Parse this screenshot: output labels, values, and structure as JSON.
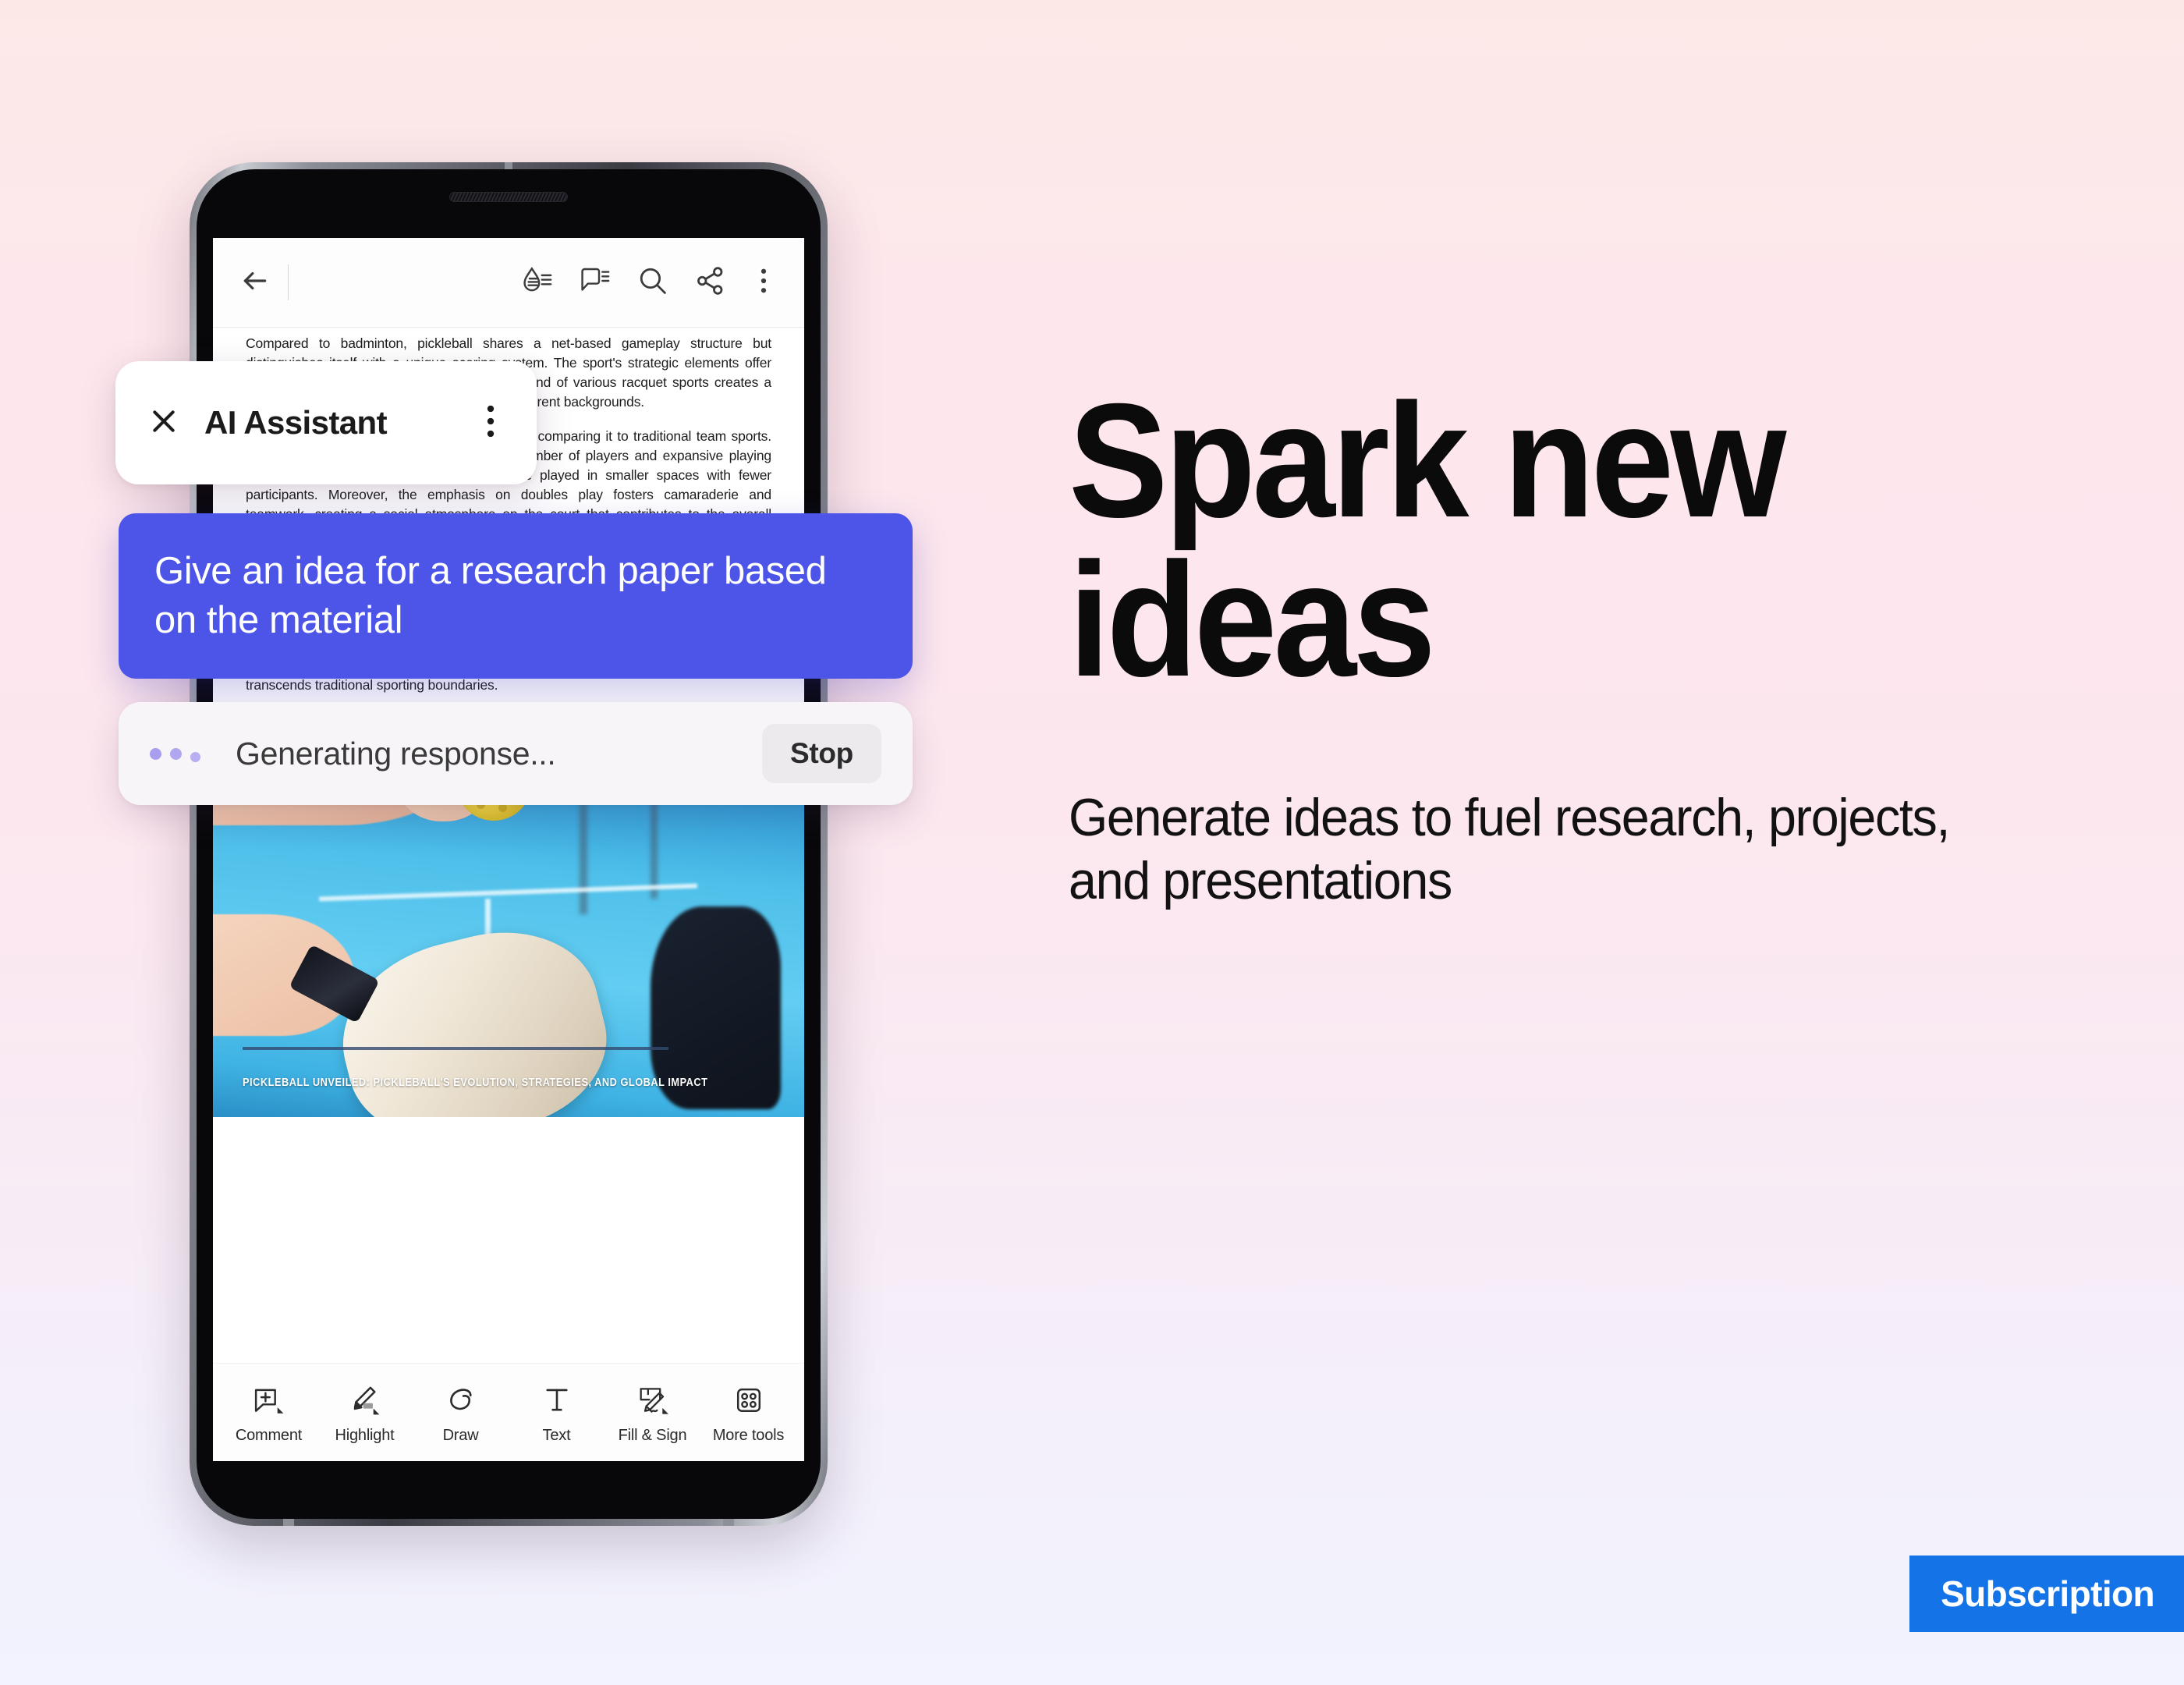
{
  "background": {
    "gradient_top": "#fce9e7",
    "gradient_bottom": "#f2f3fe"
  },
  "phone": {
    "app_toolbar": {
      "back_icon": "back-arrow-icon",
      "icons": [
        {
          "name": "liquid-mode-icon",
          "label": "Liquid Mode"
        },
        {
          "name": "comment-icon",
          "label": "Comment"
        },
        {
          "name": "search-icon",
          "label": "Search"
        },
        {
          "name": "share-icon",
          "label": "Share"
        },
        {
          "name": "more-options-icon",
          "label": "More options"
        }
      ]
    },
    "document": {
      "paragraphs": [
        "Compared to badminton, pickleball shares a net-based gameplay structure but distinguishes itself with a unique scoring system. The sport's strategic elements offer players a different set of challenges and its blend of various racquet sports creates a fusion of experience that draws players from different backgrounds.",
        "Pickleball's accessibility becomes evident when comparing it to traditional team sports. While team sports typically require a larger number of players and expansive playing areas, pickleball's adaptability allows it to be played in smaller spaces with fewer participants. Moreover, the emphasis on doubles play fosters camaraderie and teamwork, creating a social atmosphere on the court that contributes to the overall enjoyment of the game. The communal aspect, combined with the sport's relatively straightforward rules, encourages players of all ages and skill levels to engage in friendly competition and social interaction.",
        "As the pickleball community continues to grow, the sport's distinctive features and inclusive nature position it as a standout option in the realm of recreational sports. Its blend of accessibility, adaptability, and social engagement provides a compelling alternative for individuals seeking a dynamic and enjoyable athletic experience that transcends traditional sporting boundaries."
      ],
      "photo_caption": "PICKLEBALL UNVEILED: PICKLEBALL'S EVOLUTION, STRATEGIES, AND GLOBAL IMPACT"
    },
    "bottom_toolbar": [
      {
        "icon": "comment-add-icon",
        "label": "Comment"
      },
      {
        "icon": "highlight-pen-icon",
        "label": "Highlight"
      },
      {
        "icon": "draw-icon",
        "label": "Draw"
      },
      {
        "icon": "text-tool-icon",
        "label": "Text"
      },
      {
        "icon": "fill-and-sign-icon",
        "label": "Fill & Sign"
      },
      {
        "icon": "more-tools-icon",
        "label": "More tools"
      }
    ]
  },
  "ai_assistant": {
    "close_icon": "close-icon",
    "title": "AI Assistant",
    "more_icon": "more-options-icon"
  },
  "prompt_bubble": {
    "text": "Give an idea for a research paper based on the material",
    "color": "#4d54e8"
  },
  "generating": {
    "status": "Generating response...",
    "stop_label": "Stop",
    "dot_color": "#a89ef0"
  },
  "marketing": {
    "headline": "Spark new ideas",
    "subhead": "Generate ideas to fuel research, projects, and presentations"
  },
  "badge": {
    "label": "Subscription",
    "color": "#1473e6"
  }
}
